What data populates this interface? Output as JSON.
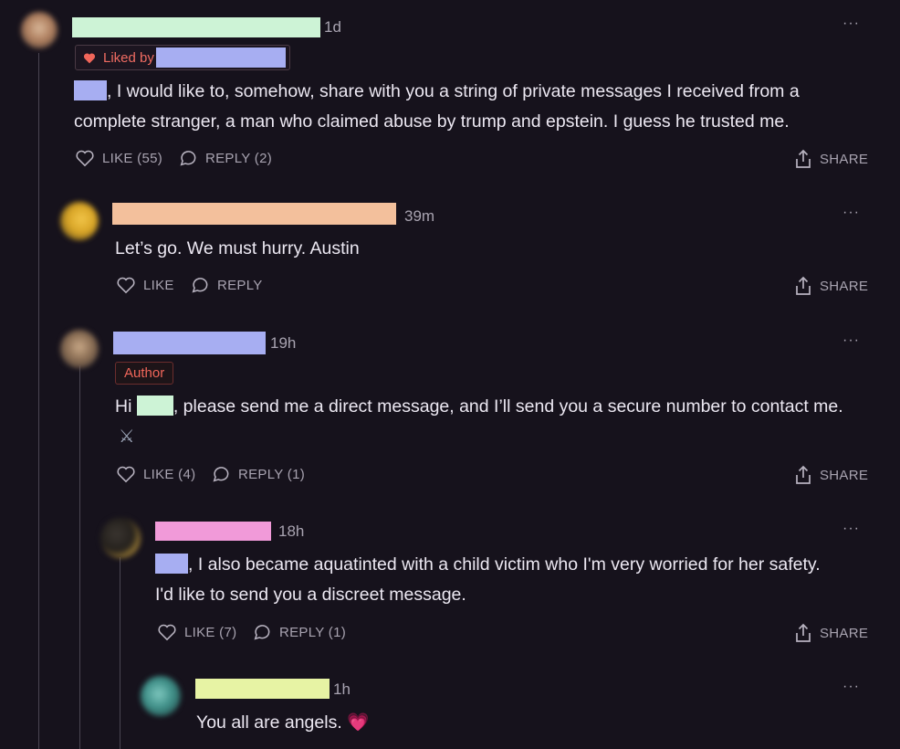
{
  "comments": [
    {
      "time": "1d",
      "liked_by_label": "Liked by",
      "text_after_redaction": ", I would like to, somehow, share with you a string of private messages I received from a complete stranger, a man who claimed abuse by trump and epstein. I guess he trusted me.",
      "like_label": "LIKE (55)",
      "reply_label": "REPLY (2)",
      "share_label": "SHARE",
      "name_bar_color": "#cdf3d6",
      "mention_bar_color": "#a7aef2"
    },
    {
      "time": "39m",
      "text": "Let’s go. We must hurry. Austin",
      "like_label": "LIKE",
      "reply_label": "REPLY",
      "share_label": "SHARE",
      "name_bar_color": "#f3c09c"
    },
    {
      "time": "19h",
      "badge": "Author",
      "text_before_redaction": "Hi",
      "text_after_redaction": ", please send me a direct message, and I’ll send you a secure number to contact me.",
      "emoji": "⚔",
      "like_label": "LIKE (4)",
      "reply_label": "REPLY (1)",
      "share_label": "SHARE",
      "name_bar_color": "#a7aef2",
      "mention_bar_color": "#cdf3d6"
    },
    {
      "time": "18h",
      "text_after_redaction": ", I also became aquatinted with a child victim who I'm very worried for her safety. I'd like to send you a discreet message.",
      "like_label": "LIKE (7)",
      "reply_label": "REPLY (1)",
      "share_label": "SHARE",
      "name_bar_color": "#f19ad9",
      "mention_bar_color": "#a7aef2"
    },
    {
      "time": "1h",
      "text": "You all are angels.",
      "emoji": "💗",
      "name_bar_color": "#e7f3a4"
    }
  ],
  "more_icon": "···",
  "colors": {
    "background": "#16121c",
    "text": "#ece8f2",
    "muted": "#a8a3b0",
    "accent_red": "#f0665a"
  }
}
